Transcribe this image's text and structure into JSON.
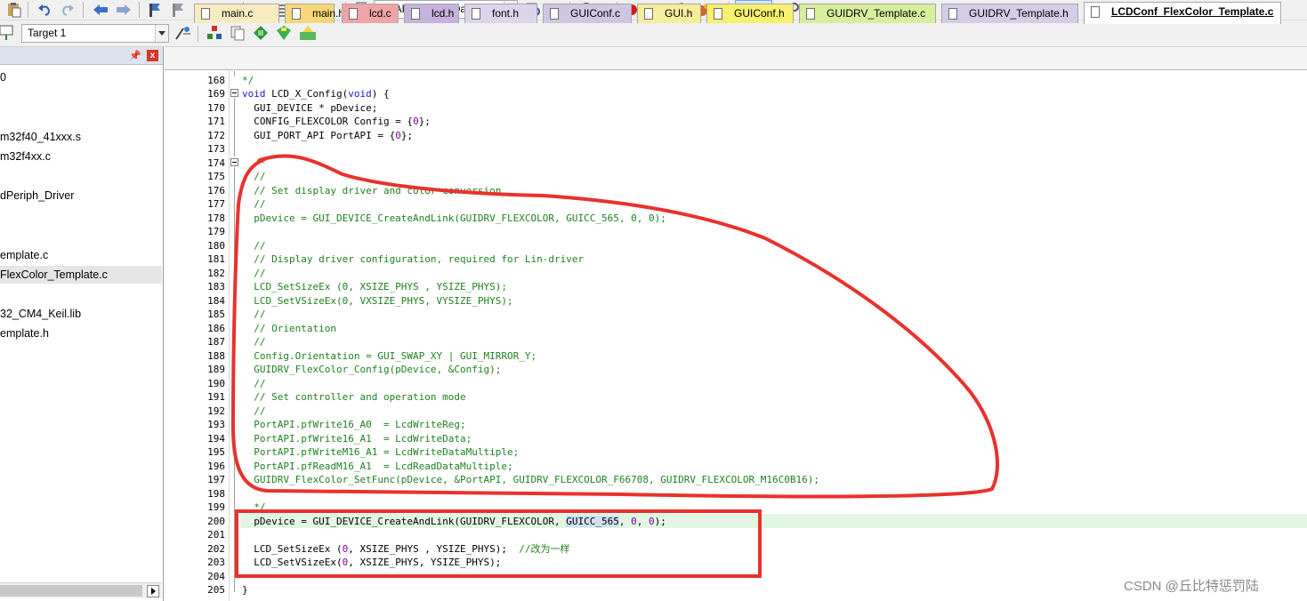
{
  "toolbar": {
    "target_combo": "USART2_SendData",
    "project_target": "Target 1"
  },
  "project_panel": {
    "items": [
      {
        "label": "0",
        "selected": false
      },
      {
        "label": "m32f40_41xxx.s",
        "selected": false
      },
      {
        "label": "m32f4xx.c",
        "selected": false
      },
      {
        "label": "dPeriph_Driver",
        "selected": false
      },
      {
        "label": "",
        "selected": false
      },
      {
        "label": "emplate.c",
        "selected": false
      },
      {
        "label": "FlexColor_Template.c",
        "selected": true
      },
      {
        "label": "32_CM4_Keil.lib",
        "selected": false
      },
      {
        "label": "emplate.h",
        "selected": false
      }
    ]
  },
  "tabs": [
    {
      "label": "main.c",
      "color": "#f7ecc0"
    },
    {
      "label": "main.h",
      "color": "#f7d779"
    },
    {
      "label": "lcd.c",
      "color": "#f0a4a6"
    },
    {
      "label": "lcd.h",
      "color": "#c6b2da"
    },
    {
      "label": "font.h",
      "color": "#dcd4ea"
    },
    {
      "label": "GUIConf.c",
      "color": "#cfc6e2"
    },
    {
      "label": "GUI.h",
      "color": "#f5ee9b"
    },
    {
      "label": "GUIConf.h",
      "color": "#f8f06e"
    },
    {
      "label": "GUIDRV_Template.c",
      "color": "#d7ef9d"
    },
    {
      "label": "GUIDRV_Template.h",
      "color": "#d5cce6"
    },
    {
      "label": "LCDConf_FlexColor_Template.c",
      "color": "#ffffff",
      "active": true
    }
  ],
  "editor": {
    "lines": [
      {
        "n": "168",
        "t": "*/",
        "cls": "cm"
      },
      {
        "n": "169",
        "t": "void LCD_X_Config(void) {",
        "cls": ""
      },
      {
        "n": "170",
        "t": "  GUI_DEVICE * pDevice;",
        "cls": ""
      },
      {
        "n": "171",
        "t": "  CONFIG_FLEXCOLOR Config = {0};",
        "cls": ""
      },
      {
        "n": "172",
        "t": "  GUI_PORT_API PortAPI = {0};",
        "cls": ""
      },
      {
        "n": "173",
        "t": "",
        "cls": ""
      },
      {
        "n": "174",
        "t": "  /*",
        "cls": "cm"
      },
      {
        "n": "175",
        "t": "  //",
        "cls": "cm"
      },
      {
        "n": "176",
        "t": "  // Set display driver and color conversion",
        "cls": "cm"
      },
      {
        "n": "177",
        "t": "  //",
        "cls": "cm"
      },
      {
        "n": "178",
        "t": "  pDevice = GUI_DEVICE_CreateAndLink(GUIDRV_FLEXCOLOR, GUICC_565, 0, 0);",
        "cls": "cm"
      },
      {
        "n": "179",
        "t": "",
        "cls": ""
      },
      {
        "n": "180",
        "t": "  //",
        "cls": "cm"
      },
      {
        "n": "181",
        "t": "  // Display driver configuration, required for Lin-driver",
        "cls": "cm"
      },
      {
        "n": "182",
        "t": "  //",
        "cls": "cm"
      },
      {
        "n": "183",
        "t": "  LCD_SetSizeEx (0, XSIZE_PHYS , YSIZE_PHYS);",
        "cls": "cm"
      },
      {
        "n": "184",
        "t": "  LCD_SetVSizeEx(0, VXSIZE_PHYS, VYSIZE_PHYS);",
        "cls": "cm"
      },
      {
        "n": "185",
        "t": "  //",
        "cls": "cm"
      },
      {
        "n": "186",
        "t": "  // Orientation",
        "cls": "cm"
      },
      {
        "n": "187",
        "t": "  //",
        "cls": "cm"
      },
      {
        "n": "188",
        "t": "  Config.Orientation = GUI_SWAP_XY | GUI_MIRROR_Y;",
        "cls": "cm"
      },
      {
        "n": "189",
        "t": "  GUIDRV_FlexColor_Config(pDevice, &Config);",
        "cls": "cm"
      },
      {
        "n": "190",
        "t": "  //",
        "cls": "cm"
      },
      {
        "n": "191",
        "t": "  // Set controller and operation mode",
        "cls": "cm"
      },
      {
        "n": "192",
        "t": "  //",
        "cls": "cm"
      },
      {
        "n": "193",
        "t": "  PortAPI.pfWrite16_A0  = LcdWriteReg;",
        "cls": "cm"
      },
      {
        "n": "194",
        "t": "  PortAPI.pfWrite16_A1  = LcdWriteData;",
        "cls": "cm"
      },
      {
        "n": "195",
        "t": "  PortAPI.pfWriteM16_A1 = LcdWriteDataMultiple;",
        "cls": "cm"
      },
      {
        "n": "196",
        "t": "  PortAPI.pfReadM16_A1  = LcdReadDataMultiple;",
        "cls": "cm"
      },
      {
        "n": "197",
        "t": "  GUIDRV_FlexColor_SetFunc(pDevice, &PortAPI, GUIDRV_FLEXCOLOR_F66708, GUIDRV_FLEXCOLOR_M16C0B16);",
        "cls": "cm"
      },
      {
        "n": "198",
        "t": "",
        "cls": ""
      },
      {
        "n": "199",
        "t": "  */",
        "cls": "cm"
      },
      {
        "n": "200",
        "t": "  pDevice = GUI_DEVICE_CreateAndLink(GUIDRV_FLEXCOLOR, GUICC_565, 0, 0);",
        "cls": ""
      },
      {
        "n": "201",
        "t": "",
        "cls": ""
      },
      {
        "n": "202",
        "t": "  LCD_SetSizeEx (0, XSIZE_PHYS , YSIZE_PHYS);  //改为一样",
        "cls": ""
      },
      {
        "n": "203",
        "t": "  LCD_SetVSizeEx(0, XSIZE_PHYS, YSIZE_PHYS);",
        "cls": ""
      },
      {
        "n": "204",
        "t": "",
        "cls": ""
      },
      {
        "n": "205",
        "t": "}",
        "cls": ""
      }
    ]
  },
  "watermark": "CSDN @丘比特惩罚陆",
  "colors": {
    "annotation": "#e8322c",
    "current_line": "#e3f6e3"
  }
}
